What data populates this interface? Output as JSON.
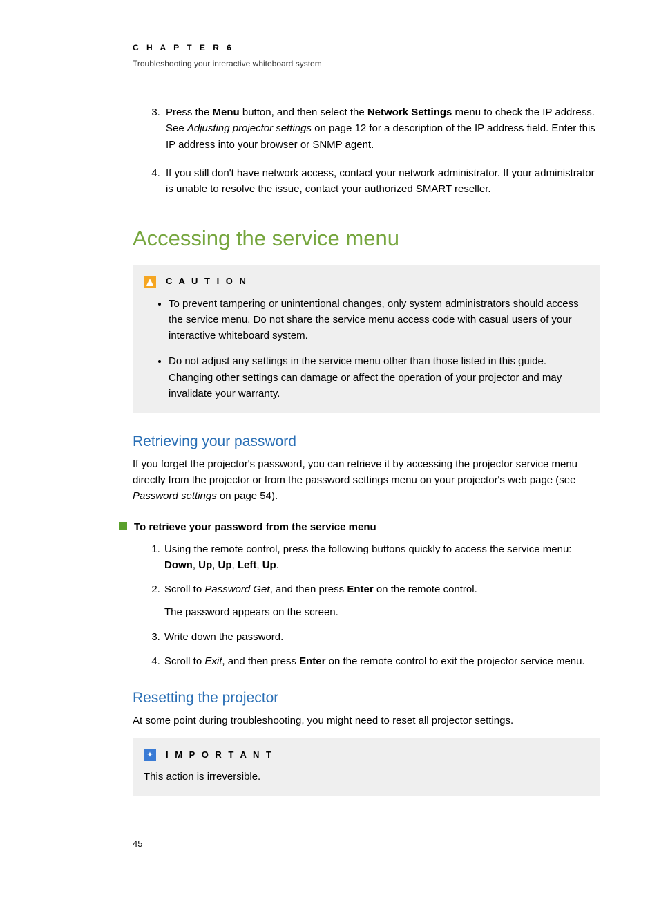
{
  "header": {
    "chapter": "C H A P T E R   6",
    "subtitle": "Troubleshooting your interactive whiteboard system"
  },
  "toplist": {
    "start": 3,
    "item3_a": "Press the ",
    "item3_b": "Menu",
    "item3_c": " button, and then select the ",
    "item3_d": "Network Settings",
    "item3_e": " menu to check the IP address. See ",
    "item3_f": "Adjusting projector settings",
    "item3_g": " on page 12 for a description of the IP address field. Enter this IP address into your browser or SNMP agent.",
    "item4": "If you still don't have network access, contact your network administrator. If your administrator is unable to resolve the issue, contact your authorized SMART reseller."
  },
  "h1": "Accessing the service menu",
  "caution": {
    "label": "C A U T I O N",
    "b1": "To prevent tampering or unintentional changes, only system administrators should access the service menu. Do not share the service menu access code with casual users of your interactive whiteboard system.",
    "b2": "Do not adjust any settings in the service menu other than those listed in this guide. Changing other settings can damage or affect the operation of your projector and may invalidate your warranty."
  },
  "retrieve": {
    "heading": "Retrieving your password",
    "para_a": "If you forget the projector's password, you can retrieve it by accessing the projector service menu directly from the projector or from the password settings menu on your projector's web page (see ",
    "para_b": "Password settings",
    "para_c": " on page 54).",
    "task": "To retrieve your password from the service menu",
    "s1_a": "Using the remote control, press the following buttons quickly to access the service menu: ",
    "s1_b": "Down",
    "s1_c": ", ",
    "s1_d": "Up",
    "s1_e": ", ",
    "s1_f": "Up",
    "s1_g": ", ",
    "s1_h": "Left",
    "s1_i": ", ",
    "s1_j": "Up",
    "s1_k": ".",
    "s2_a": "Scroll to ",
    "s2_b": "Password Get",
    "s2_c": ",  and then press ",
    "s2_d": "Enter",
    "s2_e": " on the remote control.",
    "s2_f": "The password appears on the screen.",
    "s3": "Write down the password.",
    "s4_a": "Scroll to ",
    "s4_b": "Exit",
    "s4_c": ",  and then press ",
    "s4_d": "Enter",
    "s4_e": " on the remote control to exit the projector service menu."
  },
  "reset": {
    "heading": "Resetting the projector",
    "para": "At some point during troubleshooting, you might need to reset all projector settings."
  },
  "important": {
    "label": "I M P O R T A N T",
    "body": "This action is irreversible."
  },
  "pagenum": "45"
}
